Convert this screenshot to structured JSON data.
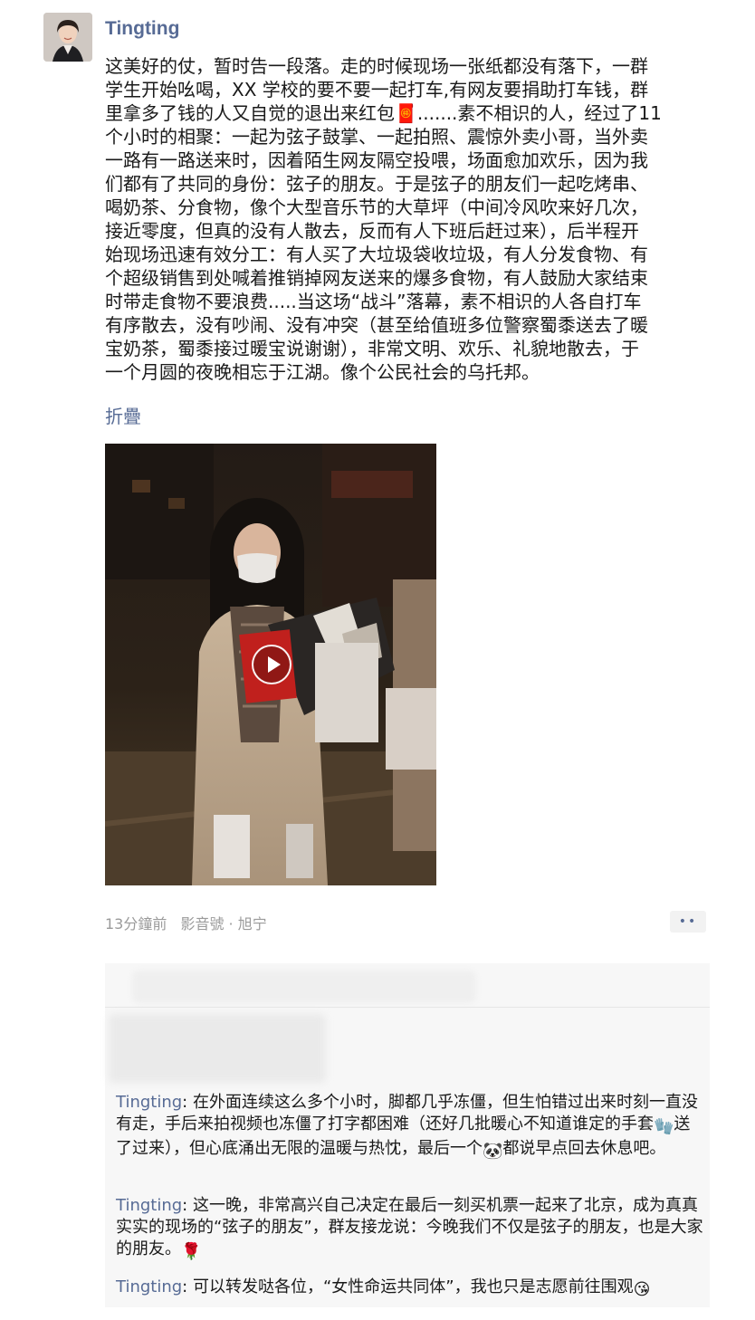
{
  "post": {
    "author": "Tingting",
    "text": "这美好的仗，暂时告一段落。走的时候现场一张纸都没有落下，一群\n学生开始吆喝，XX 学校的要不要一起打车,有网友要捐助打车钱，群\n里拿多了钱的人又自觉的退出来红包🧧.......素不相识的人，经过了11\n个小时的相聚：一起为弦子鼓掌、一起拍照、震惊外卖小哥，当外卖\n一路有一路送来时，因着陌生网友隔空投喂，场面愈加欢乐，因为我\n们都有了共同的身份：弦子的朋友。于是弦子的朋友们一起吃烤串、\n喝奶茶、分食物，像个大型音乐节的大草坪（中间冷风吹来好几次，\n接近零度，但真的没有人散去，反而有人下班后赶过来），后半程开\n始现场迅速有效分工：有人买了大垃圾袋收垃圾，有人分发食物、有\n个超级销售到处喊着推销掉网友送来的爆多食物，有人鼓励大家结束\n时带走食物不要浪费.....当这场“战斗”落幕，素不相识的人各自打车\n有序散去，没有吵闹、没有冲突（甚至给值班多位警察蜀黍送去了暖\n宝奶茶，蜀黍接过暖宝说谢谢），非常文明、欢乐、礼貌地散去，于\n一个月圆的夜晚相忘于江湖。像个公民社会的乌托邦。",
    "fold_label": "折疊",
    "time": "13分鐘前",
    "source": "影音號 · 旭宁",
    "more_label": "••"
  },
  "icons": {
    "avatar": "user-avatar",
    "play": "play-icon",
    "more": "more-dots-icon"
  },
  "comments": [
    {
      "name": "Tingting",
      "sep": ": ",
      "text_a": "在外面连续这么多个小时，脚都几乎冻僵，但生怕错过出来时刻一直没有走，手后来拍视频也冻僵了打字都困难（还好几批暖心不知道谁定的手套",
      "emoji_a": "🧤",
      "text_b": "送了过来），但心底涌出无限的温暖与热忱，最后一个",
      "emoji_b": "🐼",
      "text_c": "都说早点回去休息吧。"
    },
    {
      "name": "Tingting",
      "sep": ": ",
      "text_a": "这一晚，非常高兴自己决定在最后一刻买机票一起来了北京，成为真真实实的现场的“弦子的朋友”，群友接龙说：今晚我们不仅是弦子的朋友，也是大家的朋友。",
      "emoji_a": "🌹"
    },
    {
      "name": "Tingting",
      "sep": ": ",
      "text_a": "可以转发哒各位，“女性命运共同体”，我也只是志愿前往围观",
      "emoji_a": "😘"
    }
  ],
  "colors": {
    "link": "#576b95",
    "meta": "#9a9a9a",
    "comment_bg": "#f7f7f7"
  }
}
